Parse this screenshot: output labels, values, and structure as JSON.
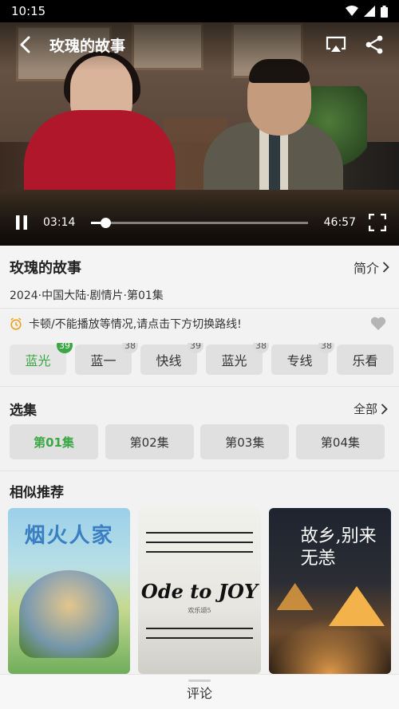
{
  "status_bar": {
    "time": "10:15"
  },
  "player": {
    "title": "玫瑰的故事",
    "current_time": "03:14",
    "total_time": "46:57",
    "progress": 0.067
  },
  "info": {
    "title": "玫瑰的故事",
    "intro_label": "简介",
    "meta": "2024·中国大陆·剧情片·第01集"
  },
  "notice": {
    "text": "卡顿/不能播放等情况,请点击下方切换路线!"
  },
  "sources": [
    {
      "label": "蓝光",
      "badge": "39",
      "active": true
    },
    {
      "label": "蓝一",
      "badge": "38",
      "active": false
    },
    {
      "label": "快线",
      "badge": "39",
      "active": false
    },
    {
      "label": "蓝光",
      "badge": "38",
      "active": false
    },
    {
      "label": "专线",
      "badge": "38",
      "active": false
    },
    {
      "label": "乐看",
      "badge": "",
      "active": false
    }
  ],
  "episodes_section": {
    "title": "选集",
    "all_label": "全部",
    "items": [
      "第01集",
      "第02集",
      "第03集",
      "第04集"
    ]
  },
  "recommend": {
    "title": "相似推荐",
    "posters": [
      {
        "title": "烟火人家"
      },
      {
        "title": "Ode to JOY",
        "subtitle": "欢乐颂5"
      },
      {
        "title": "故乡,别来无恙"
      }
    ]
  },
  "comment_bar": {
    "label": "评论"
  },
  "colors": {
    "accent": "#3aa744",
    "badge_inactive": "#dcdcdc"
  }
}
